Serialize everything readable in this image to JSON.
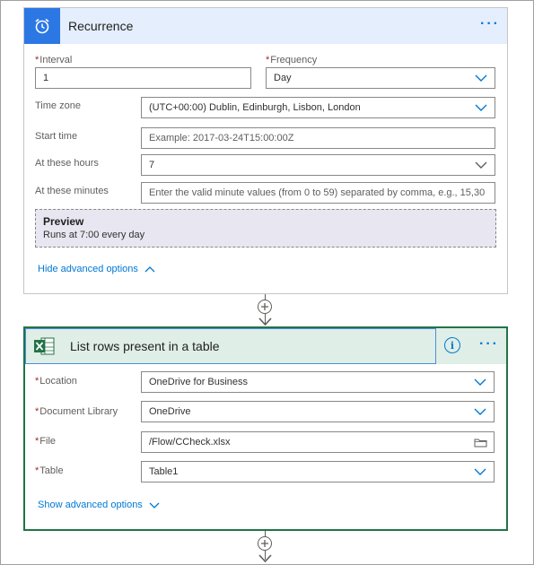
{
  "recurrence": {
    "title": "Recurrence",
    "icon": "alarm-clock-icon",
    "accent": "#2b78e4",
    "interval_label": "Interval",
    "interval_value": "1",
    "frequency_label": "Frequency",
    "frequency_value": "Day",
    "timezone_label": "Time zone",
    "timezone_value": "(UTC+00:00) Dublin, Edinburgh, Lisbon, London",
    "start_time_label": "Start time",
    "start_time_placeholder": "Example: 2017-03-24T15:00:00Z",
    "hours_label": "At these hours",
    "hours_value": "7",
    "minutes_label": "At these minutes",
    "minutes_placeholder": "Enter the valid minute values (from 0 to 59) separated by comma, e.g., 15,30",
    "preview_title": "Preview",
    "preview_text": "Runs at 7:00 every day",
    "advanced_toggle": "Hide advanced options"
  },
  "excel_action": {
    "title": "List rows present in a table",
    "icon": "excel-icon",
    "accent": "#217346",
    "location_label": "Location",
    "location_value": "OneDrive for Business",
    "library_label": "Document Library",
    "library_value": "OneDrive",
    "file_label": "File",
    "file_value": "/Flow/CCheck.xlsx",
    "table_label": "Table",
    "table_value": "Table1",
    "advanced_toggle": "Show advanced options"
  },
  "required_marker": "*",
  "more_menu": "···",
  "info_glyph": "i"
}
